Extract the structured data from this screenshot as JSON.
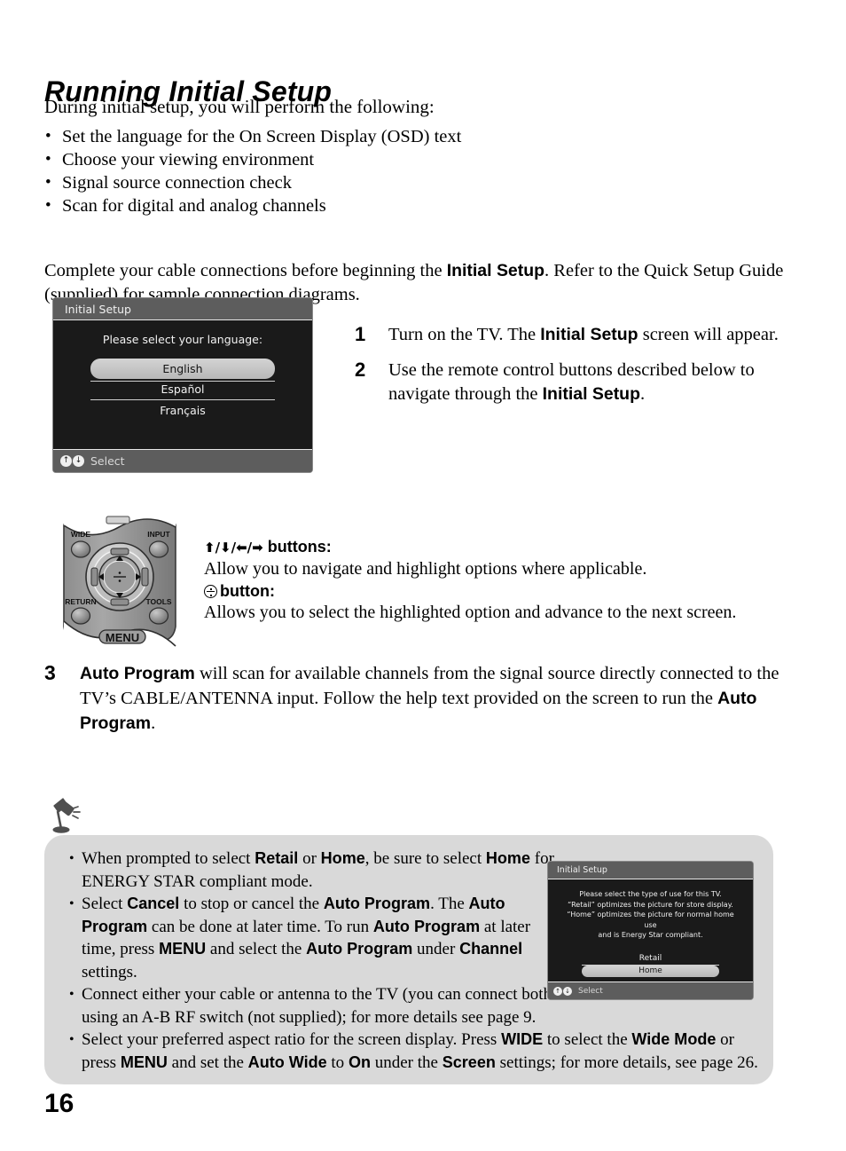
{
  "page": {
    "title": "Running Initial Setup",
    "number": "16"
  },
  "intro": {
    "lead": "During initial setup, you will perform the following:",
    "bullets": [
      "Set the language for the On Screen Display (OSD) text",
      "Choose your viewing environment",
      "Signal source connection check",
      "Scan for digital and analog channels"
    ],
    "cable_note_part1": "Complete your cable connections before beginning the ",
    "cable_note_bold": "Initial Setup",
    "cable_note_part2": ". Refer to the Quick Setup Guide (supplied) for sample connection diagrams."
  },
  "osd_language": {
    "title": "Initial Setup",
    "prompt": "Please select your language:",
    "options": [
      {
        "label": "English",
        "selected": true
      },
      {
        "label": "Español",
        "selected": false
      },
      {
        "label": "Français",
        "selected": false
      }
    ],
    "footer_label": "Select",
    "nav_up": "↑",
    "nav_down": "↓"
  },
  "steps": [
    {
      "number": "1",
      "text_part1": "Turn on the TV. The ",
      "bold1": "Initial Setup",
      "text_part2": " screen will appear.",
      "bold2": "",
      "text_part3": ""
    },
    {
      "number": "2",
      "text_part1": "Use the remote control buttons described below to navigate through the ",
      "bold1": "Initial Setup",
      "text_part2": ".",
      "bold2": "",
      "text_part3": ""
    }
  ],
  "step3": {
    "number": "3",
    "bold1": "Auto Program",
    "text1": " will scan for available channels from the signal source directly connected to the TV’s CABLE/ANTENNA input. Follow the help text provided on the screen to run the ",
    "bold2": "Auto Program",
    "text2": "."
  },
  "remote": {
    "labels": {
      "wide": "WIDE",
      "input": "INPUT",
      "return": "RETURN",
      "tools": "TOOLS",
      "menu": "MENU"
    },
    "arrows_heading_glyphs": "⬆/⬇/⬅/➡",
    "arrows_heading_suffix": " buttons:",
    "arrows_body": "Allow you to navigate and highlight options where applicable.",
    "enter_heading_suffix": "button:",
    "enter_body": "Allows you to select the highlighted option and advance to the next screen."
  },
  "tip": {
    "icon": "desk-lamp-icon",
    "bullets": [
      {
        "segments": [
          {
            "t": "When prompted to select ",
            "b": false
          },
          {
            "t": "Retail",
            "b": true
          },
          {
            "t": " or ",
            "b": false
          },
          {
            "t": "Home",
            "b": true
          },
          {
            "t": ", be sure to select ",
            "b": false
          },
          {
            "t": "Home",
            "b": true
          },
          {
            "t": " for ENERGY STAR compliant mode.",
            "b": false
          }
        ]
      },
      {
        "segments": [
          {
            "t": "Select ",
            "b": false
          },
          {
            "t": "Cancel",
            "b": true
          },
          {
            "t": " to stop or cancel the ",
            "b": false
          },
          {
            "t": "Auto Program",
            "b": true
          },
          {
            "t": ". The ",
            "b": false
          },
          {
            "t": "Auto Program",
            "b": true
          },
          {
            "t": " can be done at later time. To run ",
            "b": false
          },
          {
            "t": "Auto Program",
            "b": true
          },
          {
            "t": " at later time, press ",
            "b": false
          },
          {
            "t": "MENU",
            "b": true
          },
          {
            "t": " and select the ",
            "b": false
          },
          {
            "t": "Auto Program",
            "b": true
          },
          {
            "t": " under ",
            "b": false
          },
          {
            "t": "Channel",
            "b": true
          },
          {
            "t": " settings.",
            "b": false
          }
        ]
      },
      {
        "segments": [
          {
            "t": "Connect either your cable or antenna to the TV (you can connect both using an A-B RF switch (not supplied); for more details see page 9.",
            "b": false
          }
        ]
      },
      {
        "wide": true,
        "segments": [
          {
            "t": "Select your preferred aspect ratio for the screen display. Press ",
            "b": false
          },
          {
            "t": "WIDE",
            "b": true
          },
          {
            "t": " to select the ",
            "b": false
          },
          {
            "t": "Wide Mode",
            "b": true
          },
          {
            "t": " or press ",
            "b": false
          },
          {
            "t": "MENU",
            "b": true
          },
          {
            "t": " and set the ",
            "b": false
          },
          {
            "t": "Auto Wide",
            "b": true
          },
          {
            "t": " to ",
            "b": false
          },
          {
            "t": "On",
            "b": true
          },
          {
            "t": " under the ",
            "b": false
          },
          {
            "t": "Screen",
            "b": true
          },
          {
            "t": " settings; for more details, see page 26.",
            "b": false
          }
        ]
      }
    ]
  },
  "osd_usetype": {
    "title": "Initial Setup",
    "description_lines": [
      "Please select the type of use for this TV.",
      "“Retail” optimizes the picture for store display.",
      "“Home” optimizes the picture for normal home use",
      "and is Energy Star compliant."
    ],
    "options": [
      {
        "label": "Retail",
        "selected": false
      },
      {
        "label": "Home",
        "selected": true
      }
    ],
    "footer_label": "Select",
    "nav_up": "↑",
    "nav_down": "↓"
  },
  "colors": {
    "osd_background": "#1a1a1a",
    "osd_bar": "#5d5d5d",
    "osd_highlight": "#c6c6c6",
    "tip_box": "#d9d9d9",
    "remote_body": "#9a9a9a"
  }
}
